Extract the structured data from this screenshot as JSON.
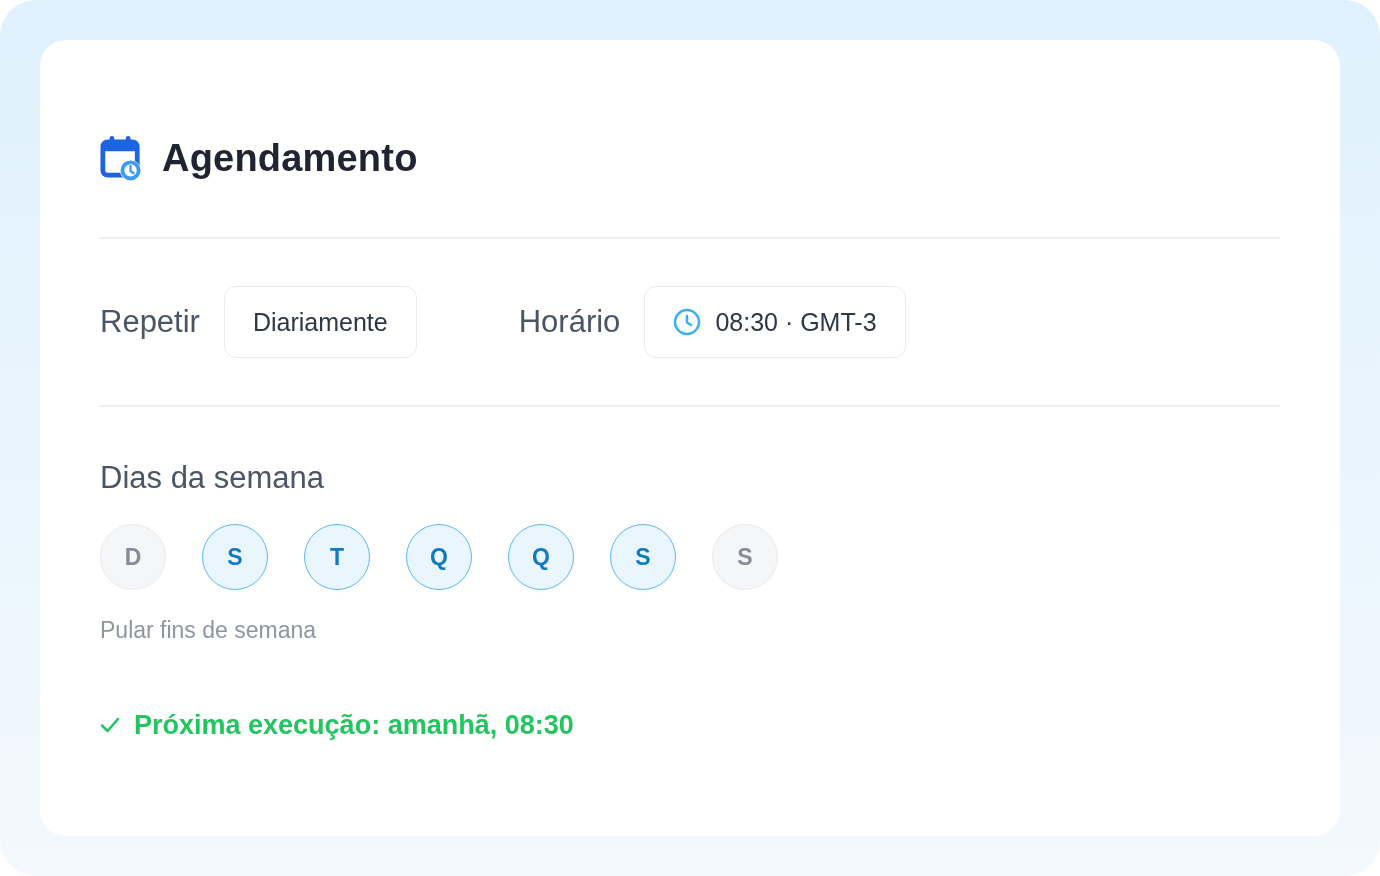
{
  "header": {
    "title": "Agendamento"
  },
  "schedule": {
    "repeat_label": "Repetir",
    "repeat_value": "Diariamente",
    "time_label": "Horário",
    "time_value": "08:30 · GMT-3"
  },
  "weekdays": {
    "title": "Dias da semana",
    "days": [
      {
        "label": "D",
        "selected": false
      },
      {
        "label": "S",
        "selected": true
      },
      {
        "label": "T",
        "selected": true
      },
      {
        "label": "Q",
        "selected": true
      },
      {
        "label": "Q",
        "selected": true
      },
      {
        "label": "S",
        "selected": true
      },
      {
        "label": "S",
        "selected": false
      }
    ],
    "hint": "Pular fins de semana"
  },
  "status": {
    "text": "Próxima execução: amanhã, 08:30"
  }
}
